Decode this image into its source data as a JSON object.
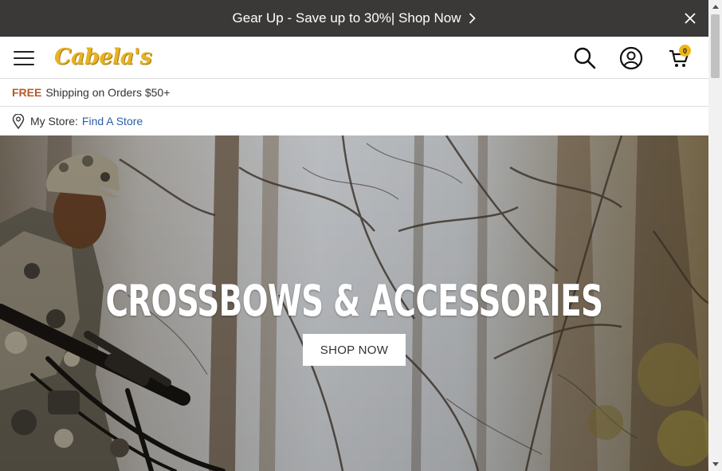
{
  "promo": {
    "text": "Gear Up - Save up to 30%| Shop Now",
    "close_icon": "close-icon",
    "chevron_icon": "chevron-right-icon"
  },
  "header": {
    "logo": "Cabela's",
    "menu_icon": "hamburger-menu-icon",
    "search_icon": "search-icon",
    "account_icon": "user-account-icon",
    "cart_icon": "cart-icon",
    "cart_count": "0"
  },
  "shipping": {
    "free": "FREE",
    "text": "Shipping on Orders $50+"
  },
  "store": {
    "label": "My Store:",
    "link": "Find A Store",
    "pin_icon": "location-pin-icon"
  },
  "hero": {
    "title": "CROSSBOWS & ACCESSORIES",
    "cta": "SHOP NOW"
  },
  "colors": {
    "promo_bg": "#3a3937",
    "free_text": "#b55a26",
    "link": "#2a5fa7",
    "logo": "#e6b325",
    "cart_badge": "#f0b617"
  }
}
